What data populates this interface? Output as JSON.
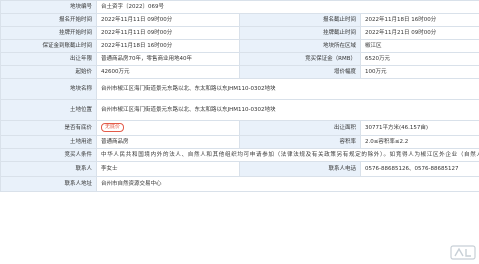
{
  "rows": {
    "r1": {
      "label": "地块编号",
      "value": "台土资字〔2022〕069号"
    },
    "r2": {
      "label1": "报名开始时间",
      "value1": "2022年11月11日 09时00分",
      "label2": "报名截止时间",
      "value2": "2022年11月18日 16时00分"
    },
    "r3": {
      "label1": "挂牌开始时间",
      "value1": "2022年11月11日 09时00分",
      "label2": "挂牌截止时间",
      "value2": "2022年11月21日 09时00分"
    },
    "r4": {
      "label1": "保证金到账截止时间",
      "value1": "2022年11月18日 16时00分",
      "label2": "地块所在区域",
      "value2": "椒江区"
    },
    "r5": {
      "label1": "出让年限",
      "value1": "普通商品房70年，零售商业用地40年",
      "label2": "竞买保证金（RMB）",
      "value2": "6520万元"
    },
    "r6": {
      "label1": "起始价",
      "value1": "42600万元",
      "label2": "增价幅度",
      "value2": "100万元"
    },
    "r7": {
      "label": "地块名称",
      "value": "台州市椒江区海门街道景元东路以北、东太和路以东JHM110-0302地块"
    },
    "r8": {
      "label": "土地位置",
      "value": "台州市椒江区海门街道景元东路以北、东太和路以东JHM110-0302地块"
    },
    "r9": {
      "label1": "是否有底价",
      "badge": "无底价",
      "label2": "出让面积",
      "value2": "30771平方米(46.157亩)"
    },
    "r10": {
      "label1": "土地用途",
      "value1": "普通商品房",
      "label2": "容积率",
      "value2": "2.0≤容积率≤2.2"
    },
    "r11": {
      "label": "竞买人条件",
      "value": "中华人民共和国境内外的法人、自然人和其他组织均可申请参加（法律法规及有关政策另有规定的除外）。如竞得人为椒江区外企业（自然人）的，须在《网上交易成交确认书》签订后2个月内在椒江区设有关规定注册成立新公司。"
    },
    "r12": {
      "label1": "联系人",
      "value1": "李女士",
      "label2": "联系人电话",
      "value2": "0576-88685126、0576-88685127"
    },
    "r13": {
      "label": "联系人地址",
      "value": "台州市自然资源交易中心"
    }
  },
  "badge_color": "#e35b4a",
  "label_bg": "#e9f1fa",
  "watermark_icon": "logo-watermark-icon"
}
